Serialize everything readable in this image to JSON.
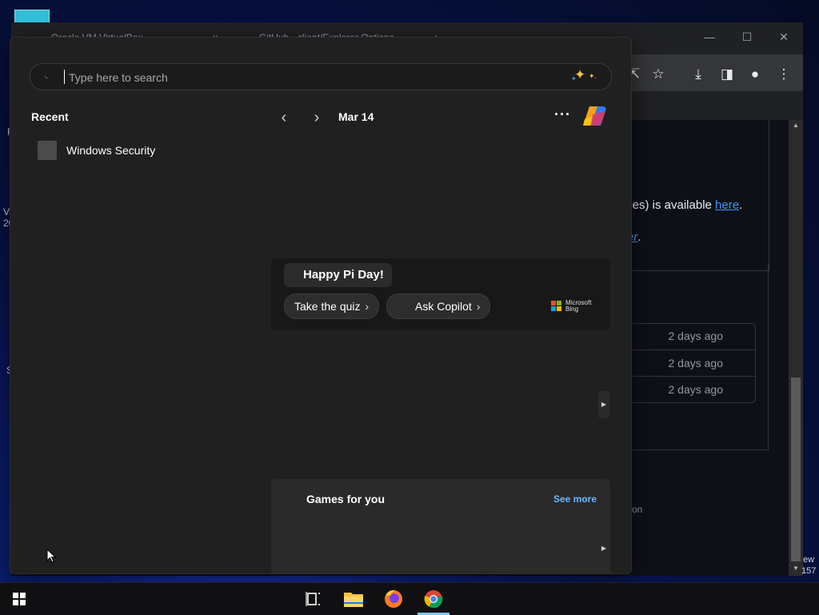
{
  "browser": {
    "tabs": [
      {
        "label": "Oracle VM VirtualBox"
      },
      {
        "label": "GitHub - client/Explorer Options"
      }
    ],
    "tab_close": "×",
    "new_tab": "+",
    "window_controls": {
      "minimize": "—",
      "maximize": "☐",
      "close": "✕"
    },
    "page_fragments": {
      "available_text": "iles) is available ",
      "here_link": "here",
      "period": ".",
      "er_link": "er",
      "er_period": ".",
      "ion_text": "tion",
      "ew_text": "ew",
      "num_text": "157",
      "edge_letters": [
        "F",
        "V",
        "20",
        "S"
      ]
    },
    "rows": [
      {
        "age": "2 days ago"
      },
      {
        "age": "2 days ago"
      },
      {
        "age": "2 days ago"
      }
    ]
  },
  "start_menu": {
    "search": {
      "placeholder": "Type here to search",
      "value": ""
    },
    "recent": {
      "title": "Recent",
      "items": [
        {
          "label": "Windows Security"
        }
      ]
    },
    "highlights": {
      "date": "Mar 14",
      "more": "···",
      "card": {
        "title": "Happy Pi Day!",
        "buttons": [
          {
            "label": "Take the quiz",
            "chevron": "›"
          },
          {
            "label": "Ask Copilot",
            "chevron": "›"
          }
        ],
        "brand": {
          "line1": "Microsoft",
          "line2": "Bing"
        }
      }
    },
    "games": {
      "title": "Games for you",
      "see_more": "See more"
    }
  },
  "colors": {
    "menu_bg": "#202020",
    "accent": "#6cb8ff",
    "link": "#4493f8"
  }
}
